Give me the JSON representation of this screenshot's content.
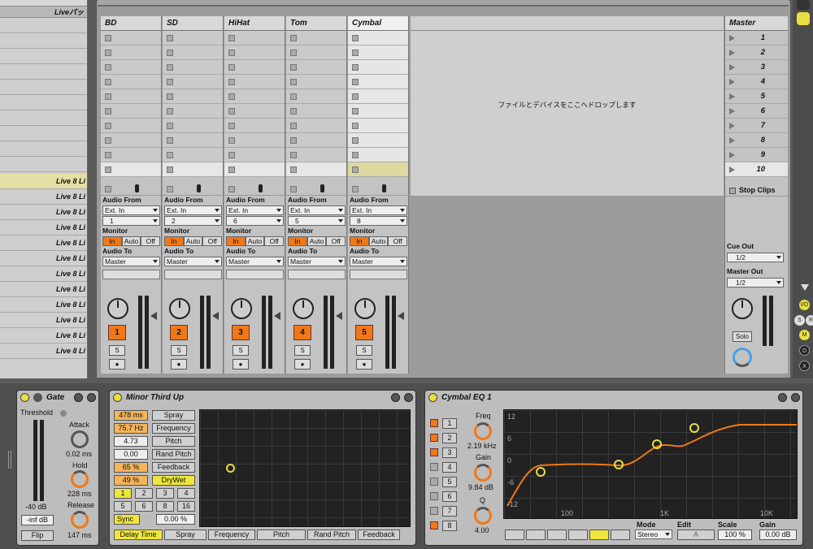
{
  "browser": {
    "header": "Liveパッ",
    "rows": [
      "Live 8 Li",
      "Live 8 Li",
      "Live 8 Li",
      "Live 8 Li",
      "Live 8 Li",
      "Live 8 Li",
      "Live 8 Li",
      "Live 8 Li",
      "Live 8 Li",
      "Live 8 Li",
      "Live 8 Li",
      "Live 8 Li"
    ]
  },
  "tracks": [
    {
      "name": "BD",
      "channel": "1",
      "number": "1"
    },
    {
      "name": "SD",
      "channel": "2",
      "number": "2"
    },
    {
      "name": "HiHat",
      "channel": "6",
      "number": "3"
    },
    {
      "name": "Tom",
      "channel": "5",
      "number": "4"
    },
    {
      "name": "Cymbal",
      "channel": "8",
      "number": "5"
    }
  ],
  "track_io": {
    "audio_from": "Audio From",
    "source": "Ext. In",
    "monitor": "Monitor",
    "mon_in": "In",
    "mon_auto": "Auto",
    "mon_off": "Off",
    "audio_to": "Audio To",
    "dest": "Master",
    "solo": "S",
    "rec": "●"
  },
  "drop_text": "ファイルとデバイスをここへドロップします",
  "master": {
    "name": "Master",
    "scenes": [
      "1",
      "2",
      "3",
      "4",
      "5",
      "6",
      "7",
      "8",
      "9",
      "10"
    ],
    "stop_clips": "Stop Clips",
    "cue_out": "Cue Out",
    "cue_value": "1/2",
    "master_out": "Master Out",
    "master_value": "1/2",
    "solo": "Solo"
  },
  "right_buttons": [
    "I/O",
    "S",
    "R",
    "M",
    "D",
    "X"
  ],
  "gate": {
    "title": "Gate",
    "threshold": "Threshold",
    "attack": "Attack",
    "attack_val": "0.02 ms",
    "hold": "Hold",
    "hold_val": "228 ms",
    "release": "Release",
    "release_val": "147 ms",
    "db": "-40 dB",
    "gain": "-inf dB",
    "flip": "Flip"
  },
  "delay": {
    "title": "Minor Third Up",
    "values": [
      "478 ms",
      "75.7 Hz",
      "4.73",
      "0.00",
      "65 %",
      "49 %"
    ],
    "labels": [
      "Spray",
      "Frequency",
      "Pitch",
      "Rand Pitch",
      "Feedback",
      "DryWet"
    ],
    "divs": [
      "1",
      "2",
      "3",
      "4",
      "5",
      "6",
      "8",
      "16"
    ],
    "sync": "Sync",
    "sync_val": "0.00 %",
    "tabs": [
      "Delay Time",
      "Spray",
      "Frequency",
      "Pitch",
      "Rand Pitch",
      "Feedback"
    ]
  },
  "eq": {
    "title": "Cymbal EQ 1",
    "bands": [
      "1",
      "2",
      "3",
      "4",
      "5",
      "6",
      "7",
      "8"
    ],
    "freq": "Freq",
    "freq_val": "2.19 kHz",
    "gain": "Gain",
    "gain_val": "9.84 dB",
    "q": "Q",
    "q_val": "4.00",
    "y_ticks": [
      "12",
      "6",
      "0",
      "-6",
      "-12"
    ],
    "x_ticks": [
      "100",
      "1K",
      "10K"
    ],
    "mode": "Mode",
    "mode_val": "Stereo",
    "edit": "Edit",
    "edit_val": "A",
    "scale": "Scale",
    "scale_val": "100 %",
    "gain2": "Gain",
    "gain2_val": "0.00 dB"
  }
}
